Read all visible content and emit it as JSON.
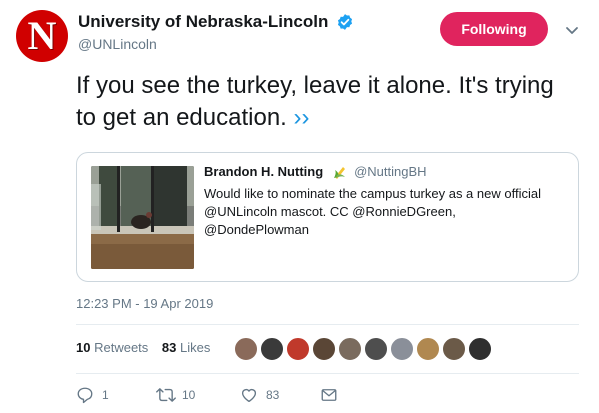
{
  "author": {
    "display_name": "University of Nebraska-Lincoln",
    "handle": "@UNLincoln",
    "avatar_letter": "N",
    "verified": true
  },
  "follow_button": {
    "label": "Following"
  },
  "tweet": {
    "text": "If you see the turkey, leave it alone. It's trying to get an education.",
    "more": "››"
  },
  "quoted_tweet": {
    "display_name": "Brandon H. Nutting",
    "handle": "@NuttingBH",
    "text": "Would like to nominate the campus turkey as a new official @UNLincoln mascot. CC @RonnieDGreen, @DondePlowman",
    "name_emoji": "corn-emoji-icon"
  },
  "timestamp": "12:23 PM - 19 Apr 2019",
  "stats": {
    "retweets_count": "10",
    "retweets_label": "Retweets",
    "likes_count": "83",
    "likes_label": "Likes"
  },
  "likers": [
    {
      "name": "liker-avatar-1",
      "color": "#8a6a5a"
    },
    {
      "name": "liker-avatar-2",
      "color": "#3a3a3a"
    },
    {
      "name": "liker-avatar-3",
      "color": "#c0392b"
    },
    {
      "name": "liker-avatar-4",
      "color": "#5a4636"
    },
    {
      "name": "liker-avatar-5",
      "color": "#7a6b5e"
    },
    {
      "name": "liker-avatar-6",
      "color": "#4e4e4e"
    },
    {
      "name": "liker-avatar-7",
      "color": "#8a8f99"
    },
    {
      "name": "liker-avatar-8",
      "color": "#b08850"
    },
    {
      "name": "liker-avatar-9",
      "color": "#6b5a48"
    },
    {
      "name": "liker-avatar-10",
      "color": "#2f2f2f"
    }
  ],
  "actions": {
    "reply_count": "1",
    "retweet_count": "10",
    "like_count": "83"
  },
  "colors": {
    "follow_bg": "#e0245e",
    "link": "#1b95e0",
    "verified": "#1da1f2",
    "brand_red": "#d00000"
  }
}
